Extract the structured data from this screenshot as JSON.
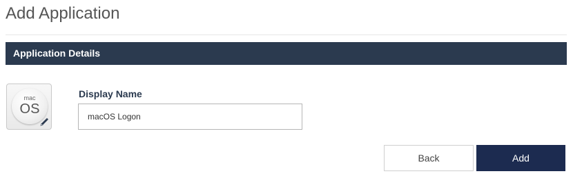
{
  "page": {
    "title": "Add Application"
  },
  "section": {
    "title": "Application Details"
  },
  "app_icon": {
    "icon": "macos-icon",
    "text_small": "mac",
    "text_large": "OS",
    "edit_icon": "pencil-icon"
  },
  "form": {
    "display_name_label": "Display Name",
    "display_name_value": "macOS Logon"
  },
  "actions": {
    "back_label": "Back",
    "add_label": "Add"
  },
  "colors": {
    "header_bg": "#2b3a4f",
    "primary_button": "#1c2b50"
  }
}
